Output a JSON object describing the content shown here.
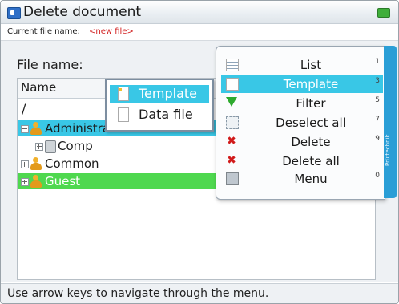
{
  "window": {
    "title": "Delete document",
    "current_file_label": "Current file name:",
    "current_file_value": "<new file>"
  },
  "main": {
    "file_name_label": "File name:",
    "list_header": "Name",
    "root_path": "/",
    "tree": [
      {
        "label": "Administrator",
        "state": "selected"
      },
      {
        "label": "Comp",
        "state": "normal"
      },
      {
        "label": "Common",
        "state": "normal"
      },
      {
        "label": "Guest",
        "state": "green"
      }
    ]
  },
  "new_popup": {
    "items": [
      {
        "label": "Template",
        "selected": true
      },
      {
        "label": "Data file",
        "selected": false
      }
    ]
  },
  "context_menu": {
    "items": [
      {
        "label": "List",
        "key": "1",
        "icon": "list-icon",
        "selected": false
      },
      {
        "label": "Template",
        "key": "3",
        "icon": "document-icon",
        "selected": true
      },
      {
        "label": "Filter",
        "key": "5",
        "icon": "filter-icon",
        "selected": false
      },
      {
        "label": "Deselect all",
        "key": "7",
        "icon": "deselect-icon",
        "selected": false
      },
      {
        "label": "Delete",
        "key": "9",
        "icon": "delete-icon",
        "selected": false
      },
      {
        "label": "Delete all",
        "key": "",
        "icon": "delete-all-icon",
        "selected": false
      },
      {
        "label": "Menu",
        "key": "0",
        "icon": "menu-icon",
        "selected": false
      }
    ],
    "side_tab": "Prüftechnik"
  },
  "status": {
    "text": "Use arrow keys to navigate through the menu."
  },
  "colors": {
    "selection": "#39c7e6",
    "green_row": "#4fd84f",
    "side_strip": "#2a9ed6"
  }
}
